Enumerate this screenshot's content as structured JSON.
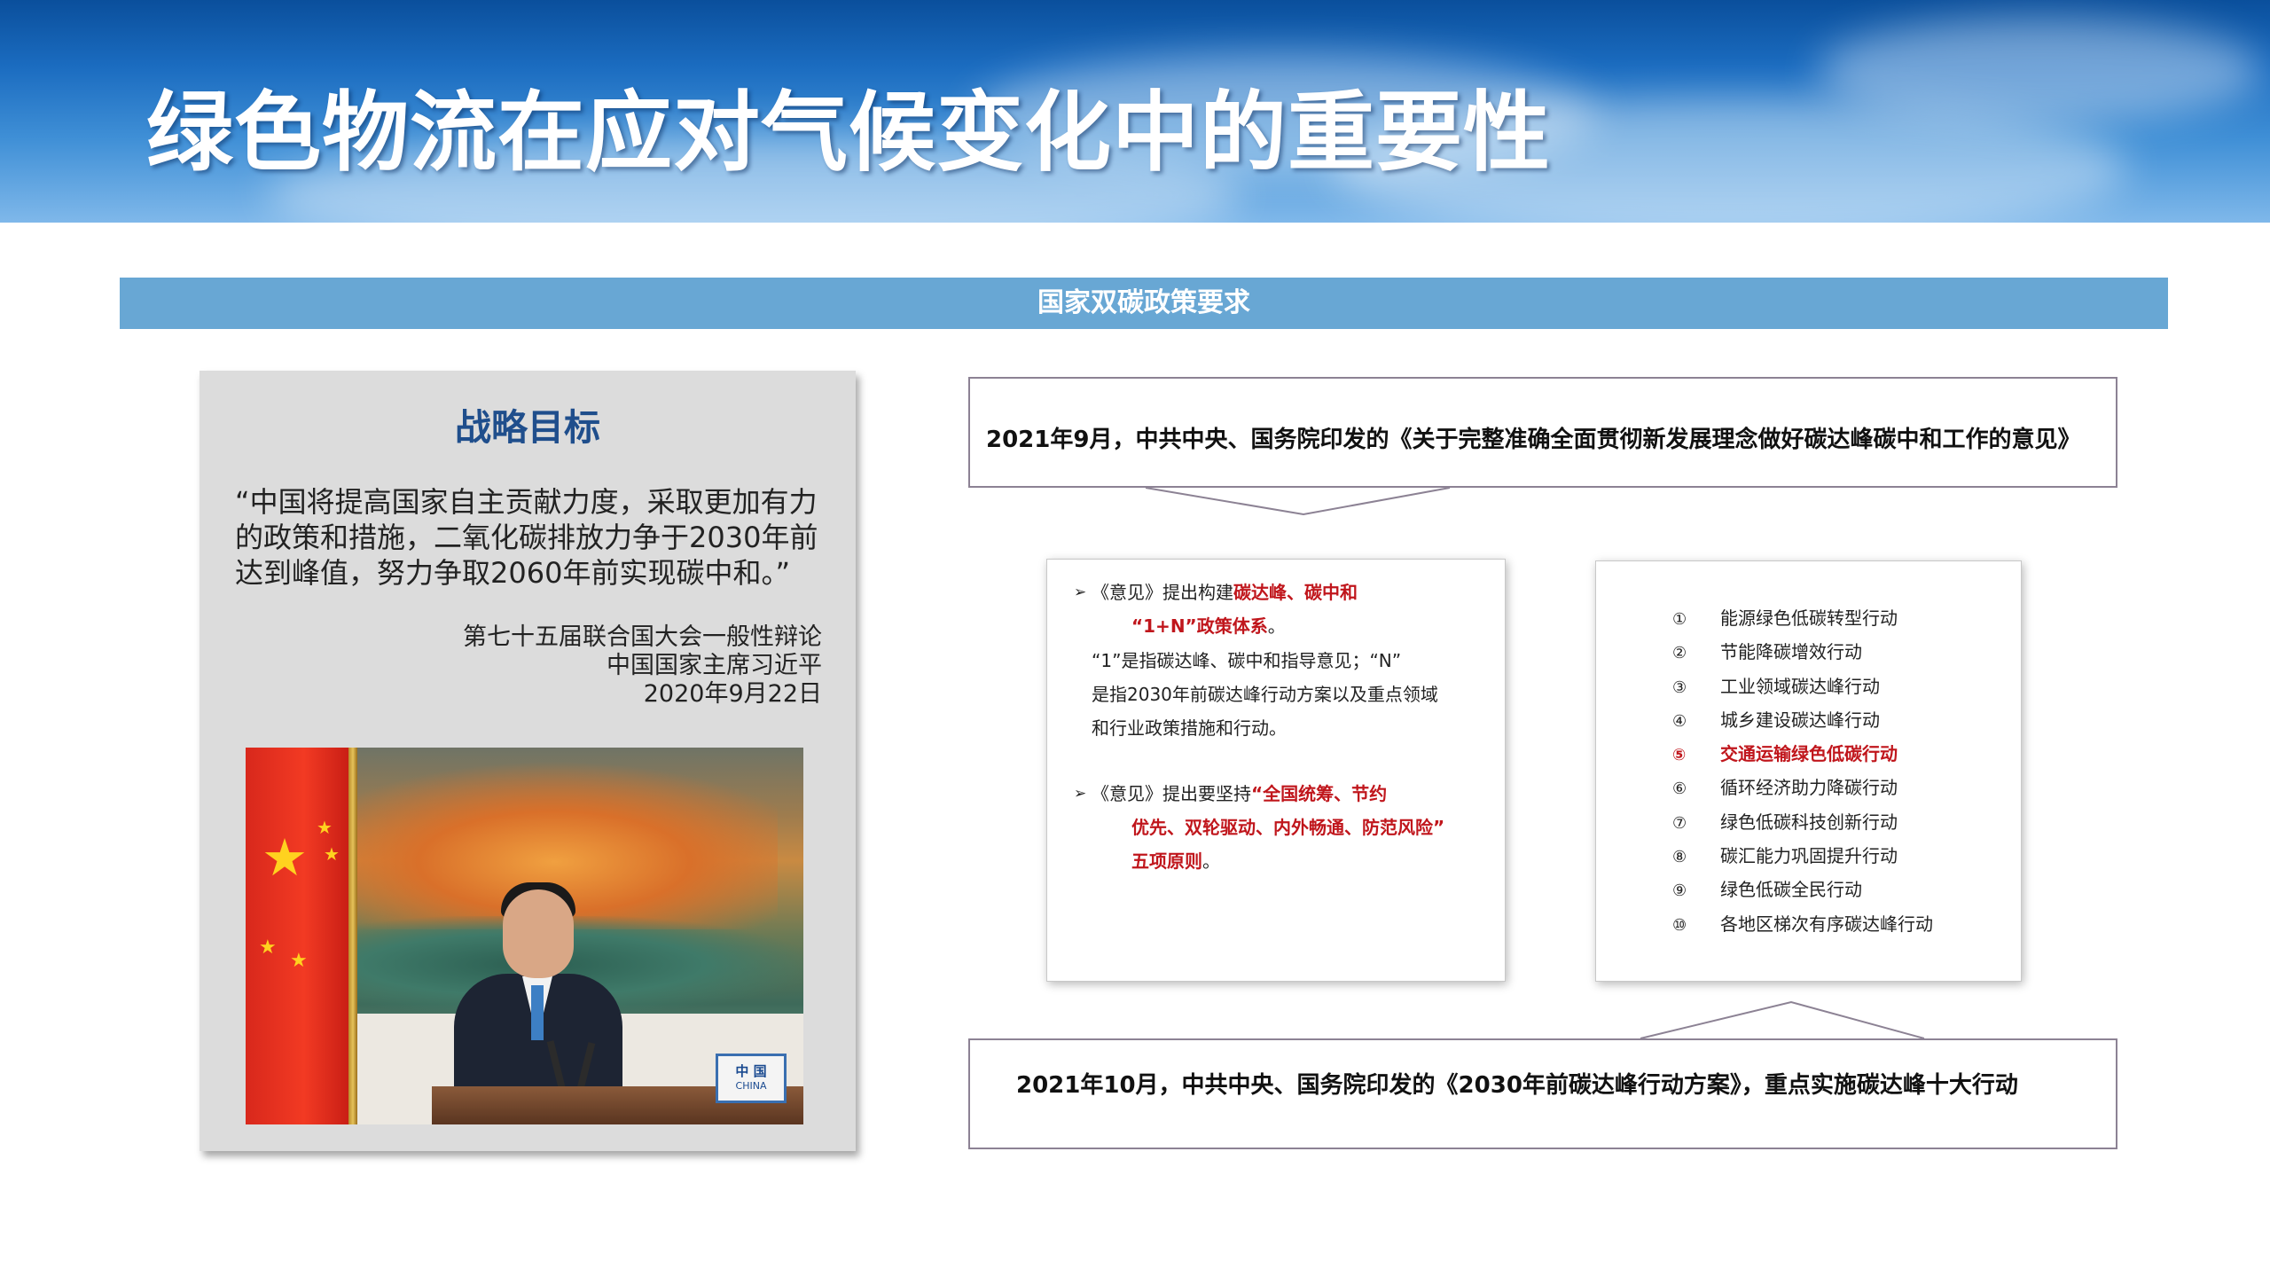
{
  "header": {
    "title": "绿色物流在应对气候变化中的重要性"
  },
  "section": {
    "label": "国家双碳政策要求"
  },
  "strategy": {
    "title": "战略目标",
    "quote": "“中国将提高国家自主贡献力度，采取更加有力的政策和措施，二氧化碳排放力争于2030年前达到峰值，努力争取2060年前实现碳中和。”",
    "attribution_line1": "第七十五届联合国大会一般性辩论",
    "attribution_line2": "中国国家主席习近平",
    "attribution_line3": "2020年9月22日"
  },
  "photo": {
    "placard_cn": "中 国",
    "placard_en": "CHINA"
  },
  "policy_top": {
    "text": "2021年9月，中共中央、国务院印发的《关于完整准确全面贯彻新发展理念做好碳达峰碳中和工作的意见》"
  },
  "opinion_points": {
    "arrow": "➢",
    "p1_prefix": "《意见》提出构建",
    "p1_red": "碳达峰、碳中和",
    "p1_red2": "“1+N”政策体系",
    "p1_suffix": "。",
    "p2_line1": "“1”是指碳达峰、碳中和指导意见；“N”",
    "p2_line2": "是指2030年前碳达峰行动方案以及重点领域",
    "p2_line3": "和行业政策措施和行动。",
    "p3_prefix": "《意见》提出要坚持",
    "p3_red1": "“全国统筹、节约",
    "p3_red2": "优先、双轮驱动、内外畅通、防范风险”",
    "p3_red3": "五项原则",
    "p3_suffix": "。"
  },
  "actions": [
    {
      "num": "①",
      "label": "能源绿色低碳转型行动",
      "highlight": false
    },
    {
      "num": "②",
      "label": "节能降碳增效行动",
      "highlight": false
    },
    {
      "num": "③",
      "label": "工业领域碳达峰行动",
      "highlight": false
    },
    {
      "num": "④",
      "label": "城乡建设碳达峰行动",
      "highlight": false
    },
    {
      "num": "⑤",
      "label": "交通运输绿色低碳行动",
      "highlight": true
    },
    {
      "num": "⑥",
      "label": "循环经济助力降碳行动",
      "highlight": false
    },
    {
      "num": "⑦",
      "label": "绿色低碳科技创新行动",
      "highlight": false
    },
    {
      "num": "⑧",
      "label": "碳汇能力巩固提升行动",
      "highlight": false
    },
    {
      "num": "⑨",
      "label": "绿色低碳全民行动",
      "highlight": false
    },
    {
      "num": "⑩",
      "label": "各地区梯次有序碳达峰行动",
      "highlight": false
    }
  ],
  "policy_bottom": {
    "text": "2021年10月，中共中央、国务院印发的《2030年前碳达峰行动方案》，重点实施碳达峰十大行动"
  },
  "colors": {
    "title_blue": "#1f4e8c",
    "highlight_red": "#c0161c",
    "section_bar": "#68a7d4",
    "border": "#8c8294"
  }
}
